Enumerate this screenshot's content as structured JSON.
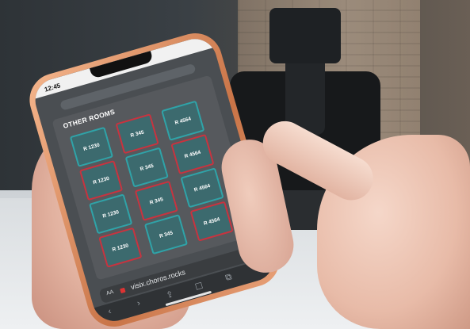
{
  "status": {
    "time": "12:45"
  },
  "panel": {
    "title": "OTHER ROOMS"
  },
  "rooms": [
    {
      "label": "R 1230",
      "outline": "teal"
    },
    {
      "label": "R 345",
      "outline": "red"
    },
    {
      "label": "R 4564",
      "outline": "teal"
    },
    {
      "label": "R 1230",
      "outline": "red"
    },
    {
      "label": "R 345",
      "outline": "teal"
    },
    {
      "label": "R 4564",
      "outline": "red"
    },
    {
      "label": "R 1230",
      "outline": "teal"
    },
    {
      "label": "R 345",
      "outline": "red"
    },
    {
      "label": "R 4564",
      "outline": "teal"
    },
    {
      "label": "R 1230",
      "outline": "red"
    },
    {
      "label": "R 345",
      "outline": "teal"
    },
    {
      "label": "R 4564",
      "outline": "red"
    }
  ],
  "browser": {
    "aa_label": "AA",
    "url": "visix.choros.rocks"
  },
  "icons": {
    "reload": "reload-icon",
    "back": "back-icon",
    "forward": "forward-icon",
    "share": "share-icon",
    "bookmarks": "book-icon",
    "tabs": "tabs-icon"
  },
  "colors": {
    "tile_fill": "#3c6a6e",
    "teal_outline": "#2fa3a8",
    "red_outline": "#c8333f",
    "panel": "#56595d"
  }
}
